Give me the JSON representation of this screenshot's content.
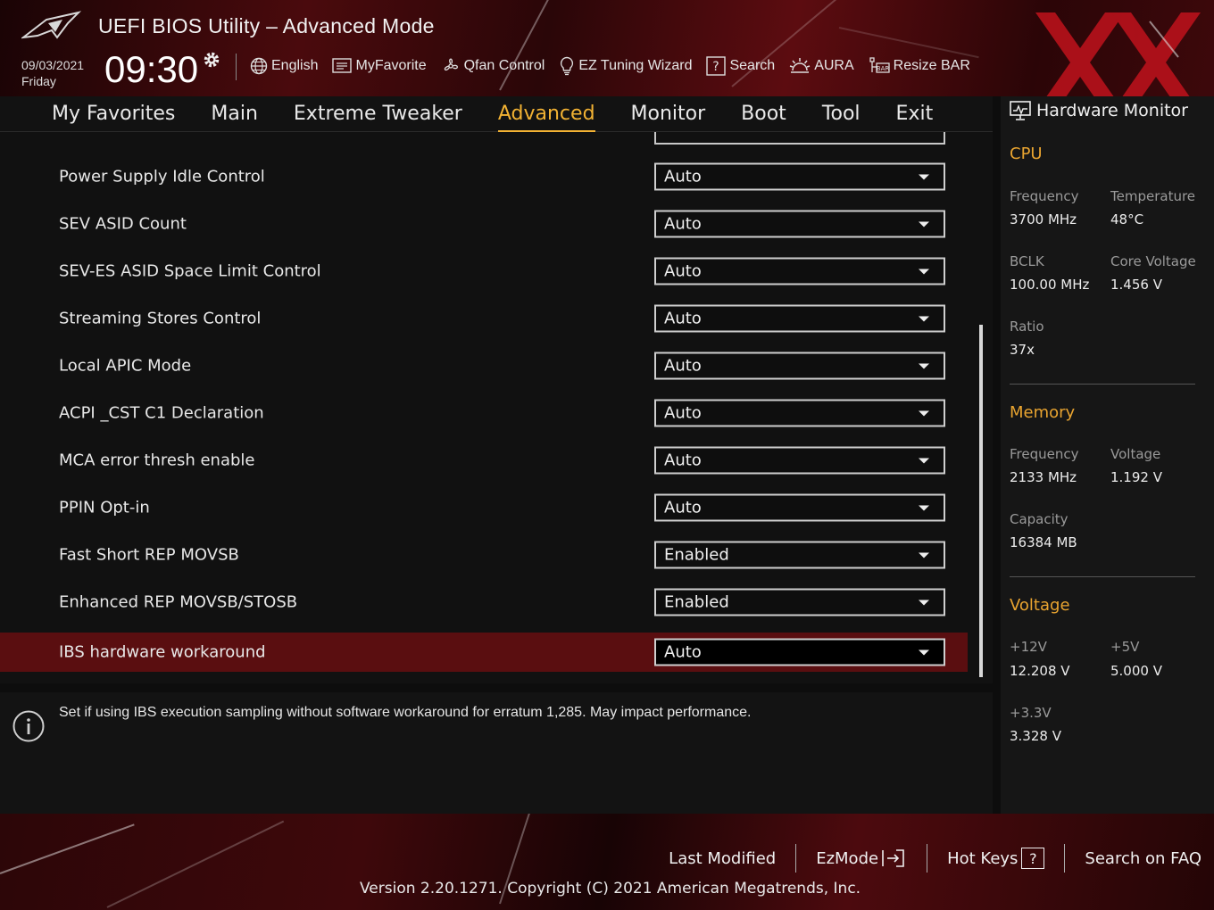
{
  "header": {
    "title": "UEFI BIOS Utility – Advanced Mode",
    "date": "09/03/2021",
    "day": "Friday",
    "time": "09:30",
    "toolbar": [
      {
        "label": "English",
        "icon": "globe-icon"
      },
      {
        "label": "MyFavorite",
        "icon": "favorite-list-icon"
      },
      {
        "label": "Qfan Control",
        "icon": "fan-icon"
      },
      {
        "label": "EZ Tuning Wizard",
        "icon": "lightbulb-icon"
      },
      {
        "label": "Search",
        "icon": "question-box-icon"
      },
      {
        "label": "AURA",
        "icon": "aura-icon"
      },
      {
        "label": "Resize BAR",
        "icon": "resize-bar-icon"
      }
    ]
  },
  "nav": {
    "tabs": [
      "My Favorites",
      "Main",
      "Extreme Tweaker",
      "Advanced",
      "Monitor",
      "Boot",
      "Tool",
      "Exit"
    ],
    "active": "Advanced"
  },
  "settings": [
    {
      "label": "Power Supply Idle Control",
      "value": "Auto"
    },
    {
      "label": "SEV ASID Count",
      "value": "Auto"
    },
    {
      "label": "SEV-ES ASID Space Limit Control",
      "value": "Auto"
    },
    {
      "label": "Streaming Stores Control",
      "value": "Auto"
    },
    {
      "label": "Local APIC Mode",
      "value": "Auto"
    },
    {
      "label": "ACPI _CST C1 Declaration",
      "value": "Auto"
    },
    {
      "label": "MCA error thresh enable",
      "value": "Auto"
    },
    {
      "label": "PPIN Opt-in",
      "value": "Auto"
    },
    {
      "label": "Fast Short REP MOVSB",
      "value": "Enabled"
    },
    {
      "label": "Enhanced REP MOVSB/STOSB",
      "value": "Enabled"
    },
    {
      "label": "IBS hardware workaround",
      "value": "Auto"
    }
  ],
  "help": {
    "text": "Set if using IBS execution sampling without software workaround for erratum 1,285. May impact performance."
  },
  "hwmon": {
    "title": "Hardware Monitor",
    "cpu": {
      "heading": "CPU",
      "frequency_label": "Frequency",
      "frequency": "3700 MHz",
      "temperature_label": "Temperature",
      "temperature": "48°C",
      "bclk_label": "BCLK",
      "bclk": "100.00 MHz",
      "core_voltage_label": "Core Voltage",
      "core_voltage": "1.456 V",
      "ratio_label": "Ratio",
      "ratio": "37x"
    },
    "memory": {
      "heading": "Memory",
      "frequency_label": "Frequency",
      "frequency": "2133 MHz",
      "voltage_label": "Voltage",
      "voltage": "1.192 V",
      "capacity_label": "Capacity",
      "capacity": "16384 MB"
    },
    "voltage": {
      "heading": "Voltage",
      "v12_label": "+12V",
      "v12": "12.208 V",
      "v5_label": "+5V",
      "v5": "5.000 V",
      "v33_label": "+3.3V",
      "v33": "3.328 V"
    }
  },
  "footer": {
    "last_modified": "Last Modified",
    "ezmode": "EzMode",
    "hotkeys": "Hot Keys",
    "hotkeys_key": "?",
    "faq": "Search on FAQ",
    "version": "Version 2.20.1271. Copyright (C) 2021 American Megatrends, Inc."
  },
  "colors": {
    "accent": "#f2b233",
    "section": "#e9a430",
    "selected_row": "#5a0e10",
    "brand_red": "#c0121c"
  }
}
